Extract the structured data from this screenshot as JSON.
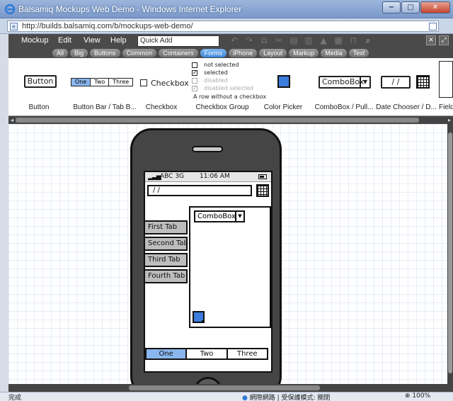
{
  "window": {
    "title": "Balsamiq Mockups Web Demo - Windows Internet Explorer",
    "minimize": "−",
    "maximize": "□",
    "close": "✕",
    "url": "http://builds.balsamiq.com/b/mockups-web-demo/"
  },
  "menubar": {
    "items": [
      "Mockup",
      "Edit",
      "View",
      "Help"
    ],
    "quick_add_placeholder": "Quick Add"
  },
  "categories": {
    "tabs": [
      "All",
      "Big",
      "Buttons",
      "Common",
      "Containers",
      "Forms",
      "iPhone",
      "Layout",
      "Markup",
      "Media",
      "Text"
    ],
    "active": "Forms"
  },
  "palette": {
    "button": {
      "text": "Button",
      "label": "Button"
    },
    "button_bar": {
      "items": [
        "One",
        "Two",
        "Three"
      ],
      "label": "Button Bar / Tab B..."
    },
    "checkbox": {
      "text": "Checkbox",
      "label": "Checkbox"
    },
    "checkbox_group": {
      "items": [
        "not selected",
        "selected",
        "disabled",
        "disabled selected"
      ],
      "note": "A row without a checkbox",
      "label": "Checkbox Group"
    },
    "color_picker": {
      "label": "Color Picker"
    },
    "combobox": {
      "text": "ComboBox",
      "label": "ComboBox / Pull..."
    },
    "date_chooser": {
      "text": "/ /",
      "label": "Date Chooser / D..."
    },
    "field": {
      "label": "Field"
    }
  },
  "phone": {
    "carrier": "ABC 3G",
    "time": "11:06 AM",
    "date_value": "/ /",
    "tabs": [
      "First Tab",
      "Second Tab",
      "Third Tab",
      "Fourth Tab"
    ],
    "combobox": "ComboBox",
    "segments": [
      "One",
      "Two",
      "Three"
    ],
    "selected_segment": "One"
  },
  "statusbar": {
    "done": "完成",
    "zone": "網際網路 | 受保護模式: 關閉",
    "zoom": "100%"
  },
  "colors": {
    "accent_blue": "#3b7ddd",
    "selected_blue": "#8ab6ee",
    "app_dark": "#4a4a4a"
  }
}
